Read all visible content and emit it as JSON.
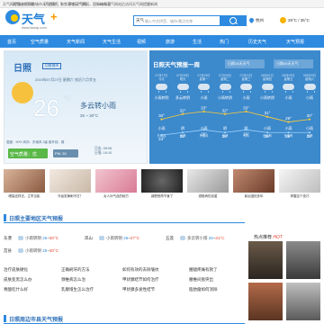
{
  "topbar": {
    "notice": "天气网提醒全国陆地城市天气预报，聚焦事态天气预报，国际城市天气网站后访问天气网提醒新闻",
    "links": [
      "天气APP下载",
      "历史天气",
      "手机天气网",
      "TAG标签"
    ]
  },
  "header": {
    "logo_text": "天气",
    "logo_plus": "+",
    "logo_url": "www.tianqi.com",
    "search_tag": "天气",
    "search_placeholder": "输入中文拼音、城市/景点名称",
    "city": "杭州",
    "city_temp": "26°C / 35°C"
  },
  "nav": [
    "首页",
    "空气质量",
    "天气新闻",
    "天气生活",
    "视频",
    "旅游",
    "生活",
    "热门",
    "历史天气",
    "天气预报"
  ],
  "today": {
    "city": "日照",
    "sub_label": "切换城市",
    "date": "2019年07月27日   星期六   农历六月廿五",
    "temp": "26",
    "deg": "°C",
    "condition": "多云转小雨",
    "range": "25 ~ 30°C",
    "meta": "湿度：90%   风向：东南风 2级   紫外线：弱",
    "aqi": "空气质量：优",
    "pm": "PM: 30",
    "sunrise": "日出: 05:06",
    "sunset": "日落: 19:10"
  },
  "week": {
    "title": "日照天气预报一周",
    "tab15": "日照15天天气",
    "tab40": "日照40天天气",
    "days": [
      {
        "date": "07月27日",
        "week": "今天",
        "cond": "小雨转阴",
        "cond2": "小雨",
        "wind": "东南风"
      },
      {
        "date": "07月28日",
        "week": "明天",
        "cond": "多云转阴",
        "cond2": "阴",
        "wind": "东风"
      },
      {
        "date": "07月29日",
        "week": "星期一",
        "cond": "小雨",
        "cond2": "小雨",
        "wind": "东南风"
      },
      {
        "date": "07月30日",
        "week": "星期二",
        "cond": "小雨转阴",
        "cond2": "阴",
        "wind": "东风"
      },
      {
        "date": "07月31日",
        "week": "星期三",
        "cond": "小雨",
        "cond2": "阴",
        "wind": "东风"
      },
      {
        "date": "08月01日",
        "week": "星期四",
        "cond": "小雨转阴",
        "cond2": "小雨",
        "wind": "东南风"
      },
      {
        "date": "08月02日",
        "week": "星期五",
        "cond": "小雨",
        "cond2": "小雨",
        "wind": "东南风"
      },
      {
        "date": "08月03日",
        "week": "星期六",
        "cond": "小雨",
        "cond2": "小雨",
        "wind": "东风"
      }
    ],
    "highs": [
      30,
      32,
      33,
      32,
      33,
      31,
      29,
      30
    ],
    "lows": [
      24,
      25,
      26,
      25,
      26,
      25,
      25,
      25
    ],
    "high_labels": [
      "30°",
      "32°",
      "33°",
      "32°",
      "33°",
      "31°",
      "29°",
      "30°"
    ],
    "low_labels": [
      "24°",
      "25°",
      "26°",
      "25°",
      "26°",
      "25°",
      "25°",
      "25°"
    ]
  },
  "ads": [
    {
      "caption": "眼袋这样去，立竿见影"
    },
    {
      "caption": "牙齿发黄刷不白？"
    },
    {
      "caption": "女人补气血的秘方"
    },
    {
      "caption": "减肥别再节食了"
    },
    {
      "caption": "颈椎病的克星"
    },
    {
      "caption": "鼻炎困扰多年"
    },
    {
      "caption": "掌握这个技巧"
    }
  ],
  "main_title": "日照主要地区天气预报",
  "cities": [
    [
      {
        "name": "东港",
        "cond": "小雨转阴",
        "hi": "30°C",
        "lo": "26"
      },
      {
        "name": "岚山",
        "cond": "小雨转阴",
        "hi": "27°C",
        "lo": "26"
      },
      {
        "name": "五莲",
        "cond": "多云转小雨",
        "hi": "31°C",
        "lo": "26"
      }
    ],
    [
      {
        "name": "莒县",
        "cond": "小雨转阴",
        "hi": "30°C",
        "lo": "25"
      }
    ]
  ],
  "links": [
    [
      "治疗皮肤硬化",
      "正确刷牙的方法",
      "如何有效的去除皱纹",
      "腰腿疼痛有救了"
    ],
    [
      "皮肤变黑怎么办",
      "颈椎病怎么治",
      "甲状腺结节如何治疗",
      "腰椎间盘突出"
    ],
    [
      "胃酸吃什么好",
      "乳腺增生怎么治疗",
      "甲状腺多发性结节",
      "脂肪瘤如何消除"
    ]
  ],
  "sec2_title": "日照周边市县天气预报",
  "hot": {
    "title_a": "热点推荐",
    "title_b": "HOT"
  }
}
